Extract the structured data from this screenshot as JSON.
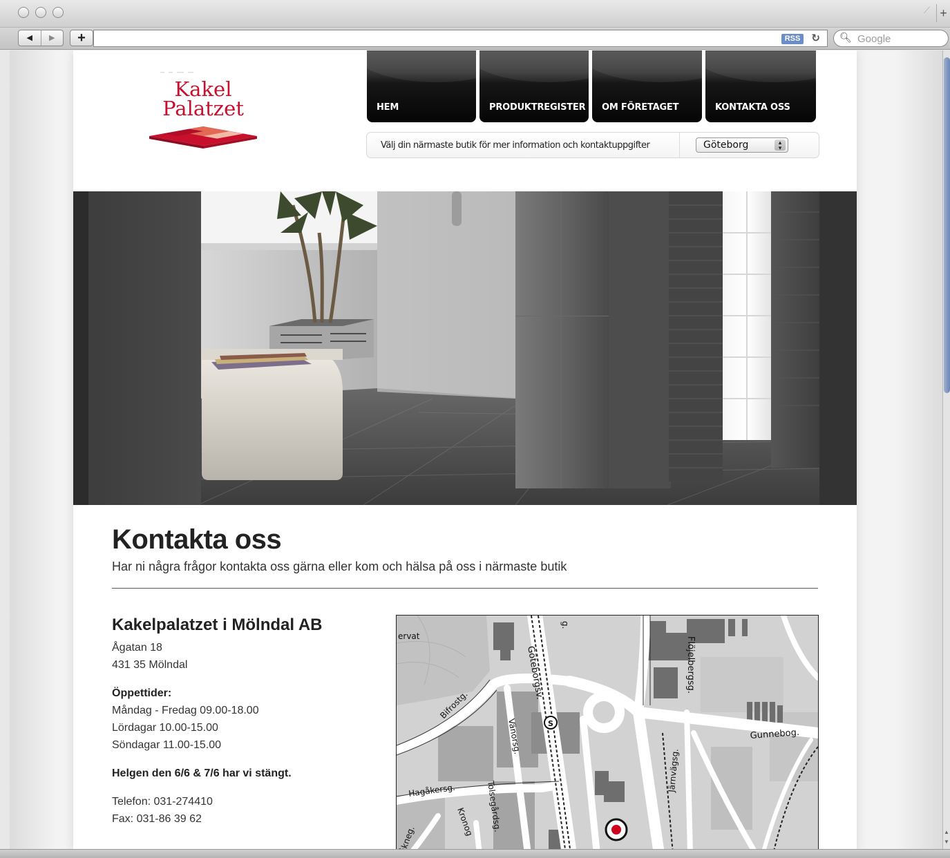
{
  "browser": {
    "nav_back": "◀",
    "nav_forward": "▶",
    "add_bookmark": "+",
    "rss": "RSS",
    "reload": "C",
    "search_placeholder": "Google",
    "new_tab": "+",
    "resize": "⟋"
  },
  "logo": {
    "line1": "Kakel",
    "line2": "Palatzet",
    "brand_color": "#c8102e"
  },
  "nav": {
    "items": [
      {
        "label": "HEM"
      },
      {
        "label": "PRODUKTREGISTER"
      },
      {
        "label": "OM FÖRETAGET"
      },
      {
        "label": "KONTAKTA OSS"
      }
    ]
  },
  "store": {
    "prompt": "Välj din närmaste butik för mer information och kontaktuppgifter",
    "selected": "Göteborg"
  },
  "content": {
    "title": "Kontakta oss",
    "lead": "Har ni några frågor kontakta oss gärna eller kom och hälsa på oss i närmaste butik"
  },
  "contact": {
    "company": "Kakelpalatzet i Mölndal AB",
    "street": "Ågatan 18",
    "city": "431 35 Mölndal",
    "hours_title": "Öppettider:",
    "hours": [
      "Måndag - Fredag 09.00-18.00",
      "Lördagar 10.00-15.00",
      "Söndagar 11.00-15.00"
    ],
    "notice": "Helgen den 6/6 & 7/6 har vi stängt.",
    "phone": "Telefon: 031-274410",
    "fax": "Fax: 031-86 39 62"
  },
  "map": {
    "labels": {
      "corner": "ervat",
      "top_g": "g.",
      "goteborgsv": "Göteborgsv.",
      "flojelbergsg": "Flöjelbergsg.",
      "bifrostg": "Bifrostg.",
      "vanorsg": "Vänorsg.",
      "gunnebog": "Gunnebog.",
      "jarnvagsg": "Järnvägsg.",
      "hagakersg": "Hagåkersg.",
      "tolsegardsg": "Tolsegårdsg.",
      "kronog": "Kronog",
      "akneg": "åkneg."
    },
    "station_symbol": "S"
  }
}
